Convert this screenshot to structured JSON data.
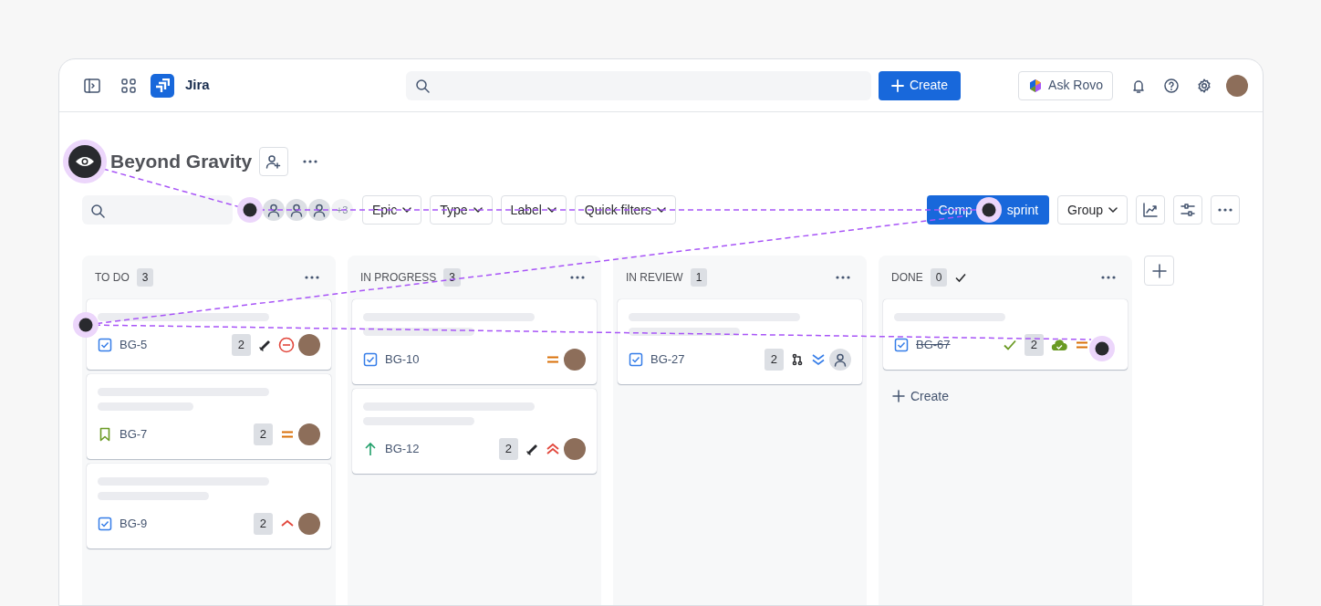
{
  "topbar": {
    "app_name": "Jira",
    "create_label": "Create",
    "ask_label": "Ask Rovo"
  },
  "project": {
    "title": "Beyond Gravity"
  },
  "filters": {
    "avatars": [
      {
        "kind": "person"
      },
      {
        "kind": "person"
      },
      {
        "kind": "person"
      }
    ],
    "more": "+3",
    "dropdowns": [
      "Epic",
      "Type",
      "Label",
      "Quick filters"
    ],
    "sprint_label_parts": [
      "Comp",
      "sprint"
    ],
    "group_label": "Group"
  },
  "columns": [
    {
      "name": "TO DO",
      "count": "3",
      "done_mark": false,
      "cards": [
        {
          "kind": "task",
          "key": "BG-5",
          "done": false,
          "lines": [
            {
              "kind": "long"
            }
          ],
          "meta": [
            {
              "kind": "estimate",
              "text": "2"
            },
            {
              "kind": "pen"
            }
          ],
          "priority": {
            "kind": "blocker"
          },
          "assignee": {
            "kind": "photo"
          }
        },
        {
          "kind": "story",
          "key": "BG-7",
          "done": false,
          "lines": [
            {
              "kind": "long"
            },
            {
              "kind": "short"
            }
          ],
          "meta": [
            {
              "kind": "estimate",
              "text": "2"
            }
          ],
          "priority": {
            "kind": "medium"
          },
          "assignee": {
            "kind": "photo"
          }
        },
        {
          "kind": "task",
          "key": "BG-9",
          "done": false,
          "lines": [
            {
              "kind": "long"
            },
            {
              "kind": "medium"
            }
          ],
          "meta": [
            {
              "kind": "estimate",
              "text": "2"
            }
          ],
          "priority": {
            "kind": "high"
          },
          "assignee": {
            "kind": "photo"
          }
        }
      ]
    },
    {
      "name": "IN PROGRESS",
      "count": "3",
      "done_mark": false,
      "cards": [
        {
          "kind": "task",
          "key": "BG-10",
          "done": false,
          "lines": [
            {
              "kind": "long"
            },
            {
              "kind": "medium"
            }
          ],
          "priority": {
            "kind": "medium"
          },
          "assignee": {
            "kind": "photo"
          }
        },
        {
          "kind": "improvement",
          "key": "BG-12",
          "done": false,
          "lines": [
            {
              "kind": "long"
            },
            {
              "kind": "medium"
            }
          ],
          "meta": [
            {
              "kind": "estimate",
              "text": "2"
            },
            {
              "kind": "pen"
            }
          ],
          "priority": {
            "kind": "highest"
          },
          "assignee": {
            "kind": "photo"
          }
        }
      ]
    },
    {
      "name": "IN REVIEW",
      "count": "1",
      "done_mark": false,
      "cards": [
        {
          "kind": "task",
          "key": "BG-27",
          "done": false,
          "lines": [
            {
              "kind": "long"
            },
            {
              "kind": "medium"
            }
          ],
          "meta": [
            {
              "kind": "estimate",
              "text": "2"
            },
            {
              "kind": "pr"
            }
          ],
          "priority": {
            "kind": "lowest"
          },
          "assignee": {
            "kind": "unassigned"
          }
        }
      ]
    },
    {
      "name": "DONE",
      "count": "0",
      "done_mark": true,
      "create_label": "Create",
      "cards": [
        {
          "kind": "task",
          "key": "BG-67",
          "done": true,
          "lines": [
            {
              "kind": "medium"
            }
          ],
          "meta": [
            {
              "kind": "check"
            },
            {
              "kind": "estimate",
              "text": "2"
            },
            {
              "kind": "cloud"
            }
          ],
          "priority": {
            "kind": "medium"
          },
          "assignee": {
            "kind": "none"
          }
        }
      ]
    }
  ]
}
